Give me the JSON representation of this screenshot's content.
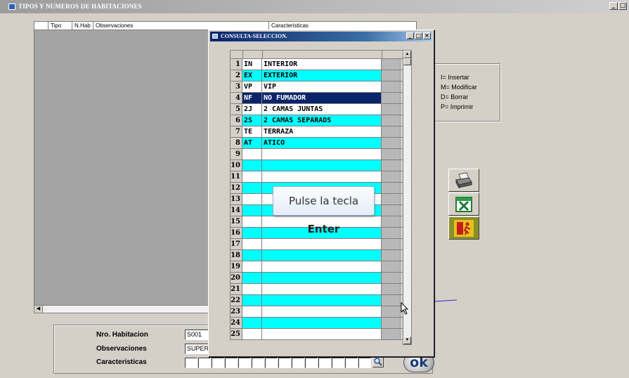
{
  "main_window": {
    "title": "TIPOS Y NUMEROS DE HABITACIONES",
    "controls": [
      "_",
      "□"
    ]
  },
  "main_grid": {
    "columns": [
      "Tipo",
      "N.Hab",
      "Observaciones",
      "Caracteristicas"
    ]
  },
  "help": {
    "lines": [
      "I= Insertar",
      "M= Modificar",
      "D= Borrar",
      "P= Imprimir"
    ]
  },
  "toolbar": {
    "buttons": [
      {
        "name": "print-button",
        "icon": "printer-icon"
      },
      {
        "name": "excel-export-button",
        "icon": "excel-icon"
      },
      {
        "name": "exit-button",
        "icon": "exit-door-icon"
      }
    ]
  },
  "form": {
    "nro_label": "Nro. Habitacion",
    "nro_value": "S001",
    "obs_label": "Observaciones",
    "obs_value": "SUPER",
    "car_label": "Caracteristicas",
    "ok_label": "ok"
  },
  "dialog": {
    "title": "CONSULTA-SELECCION.",
    "controls": [
      "_",
      "□",
      "×"
    ],
    "selected_row": 4,
    "rows": [
      {
        "n": "1",
        "code": "IN",
        "desc": "INTERIOR"
      },
      {
        "n": "2",
        "code": "EX",
        "desc": "EXTERIOR"
      },
      {
        "n": "3",
        "code": "VP",
        "desc": "VIP"
      },
      {
        "n": "4",
        "code": "NF",
        "desc": "NO FUMADOR"
      },
      {
        "n": "5",
        "code": "2J",
        "desc": "2 CAMAS JUNTAS"
      },
      {
        "n": "6",
        "code": "2S",
        "desc": "2 CAMAS SEPARADS"
      },
      {
        "n": "7",
        "code": "TE",
        "desc": "TERRAZA"
      },
      {
        "n": "8",
        "code": "AT",
        "desc": "ATICO"
      },
      {
        "n": "9",
        "code": "",
        "desc": ""
      },
      {
        "n": "10",
        "code": "",
        "desc": ""
      },
      {
        "n": "11",
        "code": "",
        "desc": ""
      },
      {
        "n": "12",
        "code": "",
        "desc": ""
      },
      {
        "n": "13",
        "code": "",
        "desc": ""
      },
      {
        "n": "14",
        "code": "",
        "desc": ""
      },
      {
        "n": "15",
        "code": "",
        "desc": ""
      },
      {
        "n": "16",
        "code": "",
        "desc": ""
      },
      {
        "n": "17",
        "code": "",
        "desc": ""
      },
      {
        "n": "18",
        "code": "",
        "desc": ""
      },
      {
        "n": "19",
        "code": "",
        "desc": ""
      },
      {
        "n": "20",
        "code": "",
        "desc": ""
      },
      {
        "n": "21",
        "code": "",
        "desc": ""
      },
      {
        "n": "22",
        "code": "",
        "desc": ""
      },
      {
        "n": "23",
        "code": "",
        "desc": ""
      },
      {
        "n": "24",
        "code": "",
        "desc": ""
      },
      {
        "n": "25",
        "code": "",
        "desc": ""
      }
    ]
  },
  "tooltip": {
    "text_before": "Pulse la tecla ",
    "key": "Enter"
  },
  "colors": {
    "row_alt": "#00ffff",
    "row_selected": "#0a246a",
    "dialog_title": "#0a246a"
  }
}
